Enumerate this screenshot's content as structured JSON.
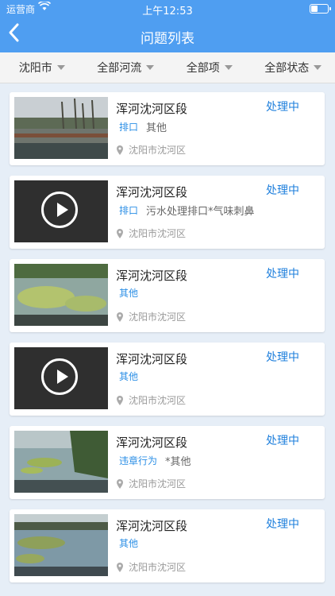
{
  "status_bar": {
    "carrier": "运营商",
    "time": "上午12:53",
    "battery_level": 0.45
  },
  "header": {
    "title": "问题列表"
  },
  "filters": [
    {
      "label": "沈阳市"
    },
    {
      "label": "全部河流"
    },
    {
      "label": "全部项"
    },
    {
      "label": "全部状态"
    }
  ],
  "items": [
    {
      "name": "浑河沈河区段",
      "status": "处理中",
      "tag": "排口",
      "description": "其他",
      "location": "沈阳市沈河区",
      "media": "photo"
    },
    {
      "name": "浑河沈河区段",
      "status": "处理中",
      "tag": "排口",
      "description": "污水处理排口*气味刺鼻",
      "location": "沈阳市沈河区",
      "media": "video"
    },
    {
      "name": "浑河沈河区段",
      "status": "处理中",
      "tag": "其他",
      "description": "",
      "location": "沈阳市沈河区",
      "media": "photo"
    },
    {
      "name": "浑河沈河区段",
      "status": "处理中",
      "tag": "其他",
      "description": "",
      "location": "沈阳市沈河区",
      "media": "video"
    },
    {
      "name": "浑河沈河区段",
      "status": "处理中",
      "tag": "违章行为",
      "description": "*其他",
      "location": "沈阳市沈河区",
      "media": "photo"
    },
    {
      "name": "浑河沈河区段",
      "status": "处理中",
      "tag": "其他",
      "description": "",
      "location": "沈阳市沈河区",
      "media": "photo"
    }
  ],
  "colors": {
    "header": "#4f9ef1",
    "status_text": "#1e7fdc",
    "tag_text": "#2c8fe6",
    "background": "#e6eef7"
  }
}
